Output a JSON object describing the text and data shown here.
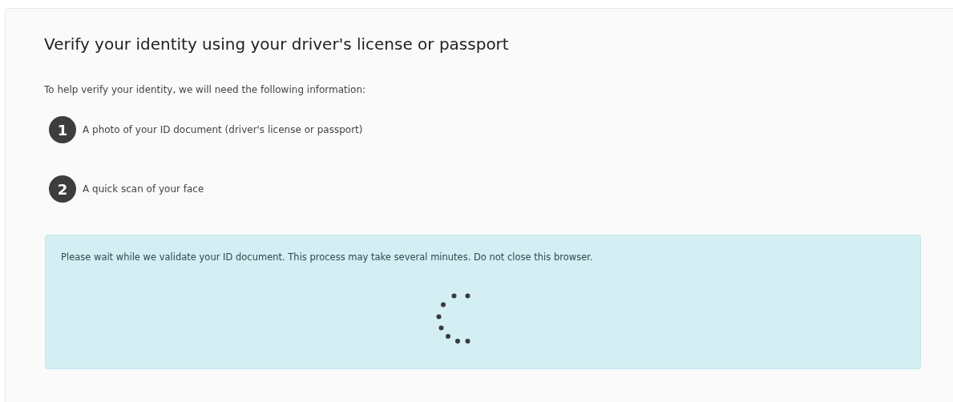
{
  "title": "Verify your identity using your driver's license or passport",
  "intro": "To help verify your identity, we will need the following information:",
  "steps": [
    {
      "number": "1",
      "text": "A photo of your ID document (driver's license or passport)"
    },
    {
      "number": "2",
      "text": "A quick scan of your face"
    }
  ],
  "notice": {
    "text": "Please wait while we validate your ID document. This process may take several minutes. Do not close this browser."
  }
}
